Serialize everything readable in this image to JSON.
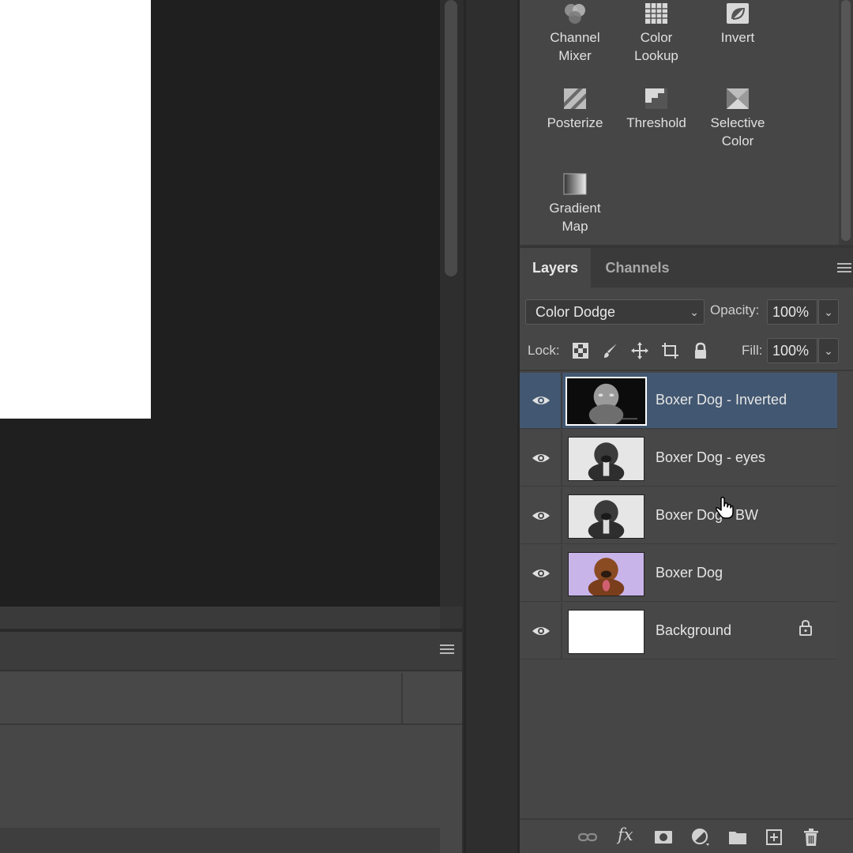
{
  "adjustments": {
    "items": [
      {
        "label_line1": "Channel",
        "label_line2": "Mixer",
        "icon": "channel-mixer-icon"
      },
      {
        "label_line1": "Color",
        "label_line2": "Lookup",
        "icon": "color-lookup-icon"
      },
      {
        "label_line1": "Invert",
        "label_line2": "",
        "icon": "invert-icon"
      },
      {
        "label_line1": "Posterize",
        "label_line2": "",
        "icon": "posterize-icon"
      },
      {
        "label_line1": "Threshold",
        "label_line2": "",
        "icon": "threshold-icon"
      },
      {
        "label_line1": "Selective",
        "label_line2": "Color",
        "icon": "selective-color-icon"
      },
      {
        "label_line1": "Gradient",
        "label_line2": "Map",
        "icon": "gradient-map-icon"
      }
    ]
  },
  "layers_panel": {
    "tabs": [
      {
        "label": "Layers",
        "active": true
      },
      {
        "label": "Channels",
        "active": false
      }
    ],
    "blend_mode": "Color Dodge",
    "opacity_label": "Opacity:",
    "opacity_value": "100%",
    "lock_label": "Lock:",
    "fill_label": "Fill:",
    "fill_value": "100%",
    "layers": [
      {
        "name": "Boxer Dog - Inverted",
        "visible": true,
        "selected": true,
        "locked": false,
        "thumb": "inverted"
      },
      {
        "name": "Boxer Dog - eyes",
        "visible": true,
        "selected": false,
        "locked": false,
        "thumb": "bw"
      },
      {
        "name": "Boxer Dog - BW",
        "visible": true,
        "selected": false,
        "locked": false,
        "thumb": "bw"
      },
      {
        "name": "Boxer Dog",
        "visible": true,
        "selected": false,
        "locked": false,
        "thumb": "color"
      },
      {
        "name": "Background",
        "visible": true,
        "selected": false,
        "locked": true,
        "thumb": "white"
      }
    ],
    "bottom_icons": [
      "link-layers-icon",
      "fx-icon",
      "add-mask-icon",
      "adjustment-layer-icon",
      "new-group-icon",
      "new-layer-icon",
      "delete-layer-icon"
    ]
  },
  "colors": {
    "selected_layer": "#425771",
    "panel_bg": "#464646",
    "canvas_bg": "#1f1f1f"
  }
}
